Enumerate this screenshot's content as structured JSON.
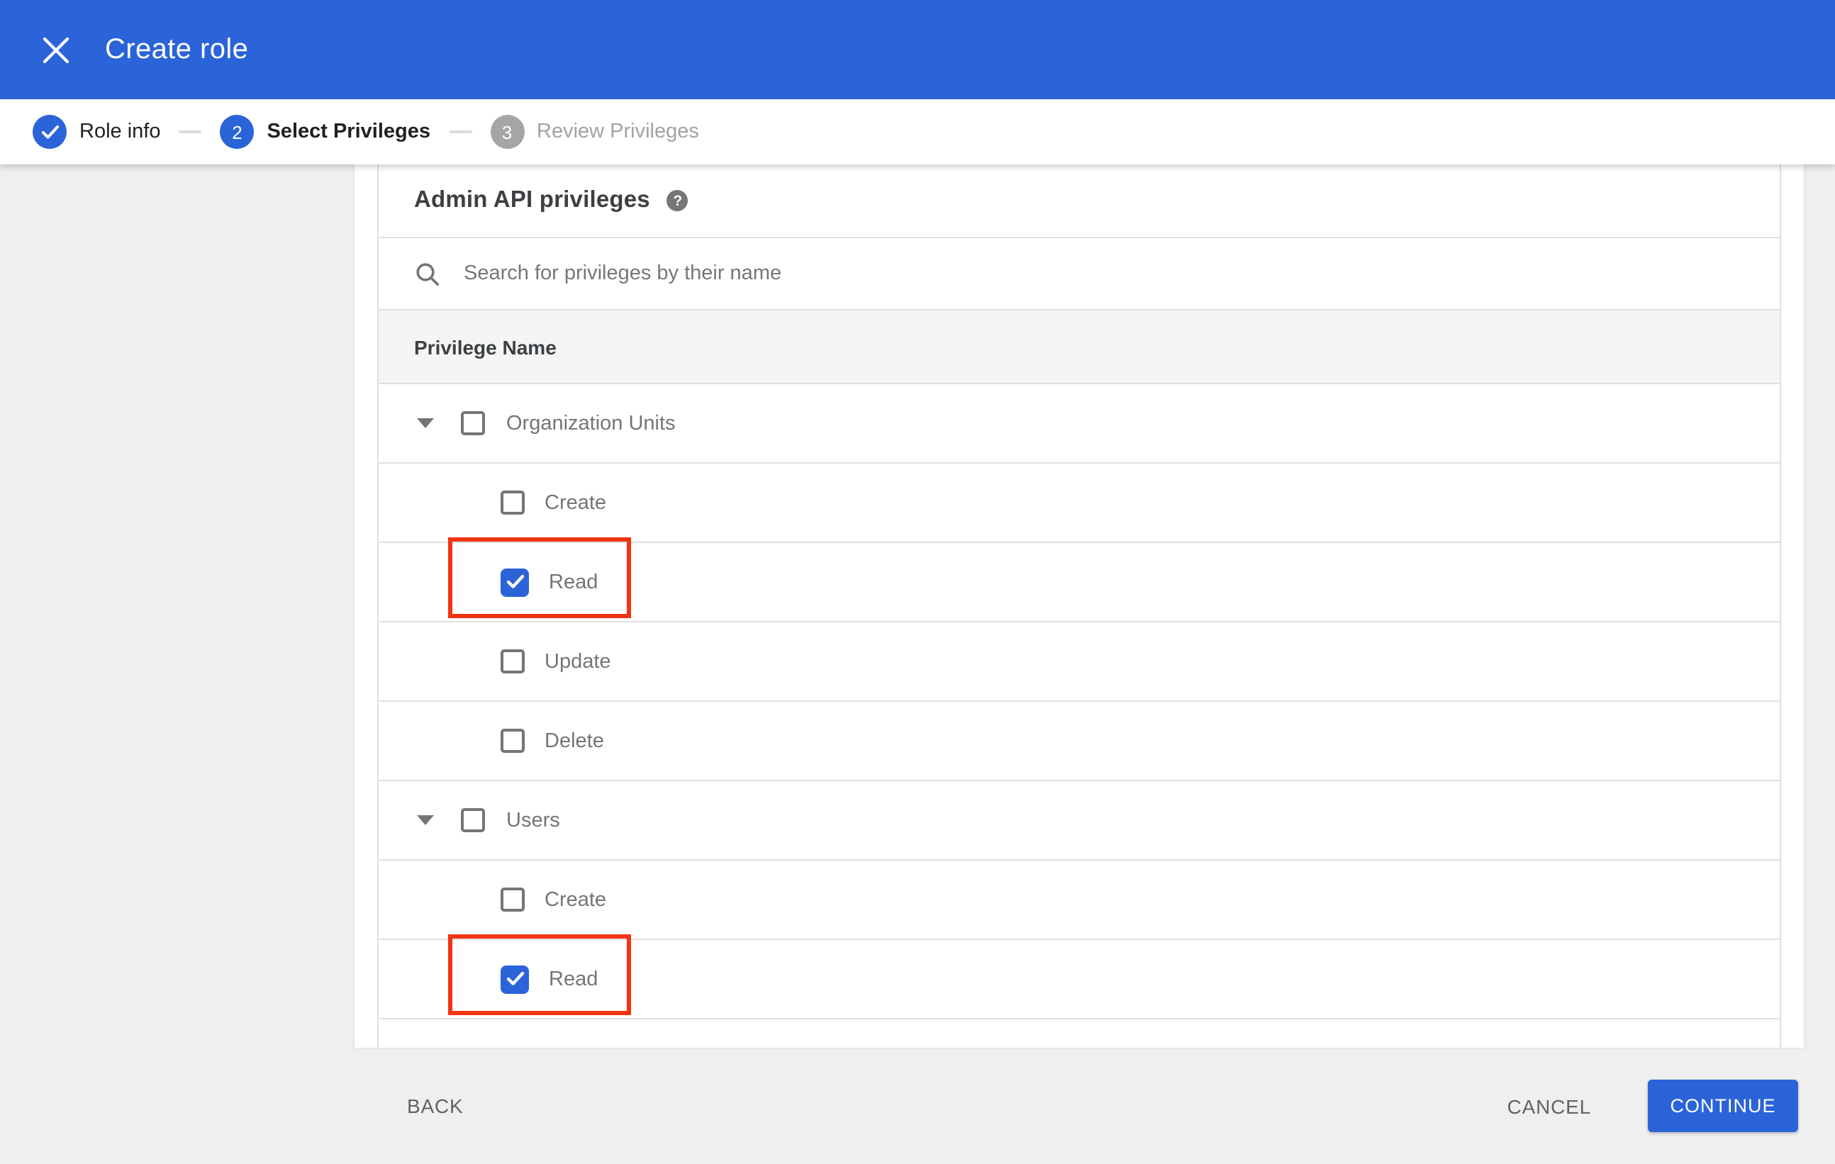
{
  "header": {
    "title": "Create role"
  },
  "stepper": {
    "steps": [
      {
        "num": "",
        "label": "Role info",
        "state": "done"
      },
      {
        "num": "2",
        "label": "Select Privileges",
        "state": "active"
      },
      {
        "num": "3",
        "label": "Review Privileges",
        "state": "upcoming"
      }
    ]
  },
  "content": {
    "section_title": "Admin API privileges",
    "help_icon": "?",
    "search_placeholder": "Search for privileges by their name",
    "table": {
      "header": "Privilege Name",
      "rows": [
        {
          "label": "Organization Units",
          "type": "group",
          "checked": false
        },
        {
          "label": "Create",
          "type": "child",
          "checked": false
        },
        {
          "label": "Read",
          "type": "child",
          "checked": true,
          "highlighted": true
        },
        {
          "label": "Update",
          "type": "child",
          "checked": false
        },
        {
          "label": "Delete",
          "type": "child",
          "checked": false
        },
        {
          "label": "Users",
          "type": "group",
          "checked": false
        },
        {
          "label": "Create",
          "type": "child",
          "checked": false
        },
        {
          "label": "Read",
          "type": "child",
          "checked": true,
          "highlighted": true
        }
      ]
    }
  },
  "footer": {
    "back_label": "BACK",
    "cancel_label": "CANCEL",
    "continue_label": "CONTINUE"
  },
  "colors": {
    "accent_blue": "#2b63d9",
    "annotation_red": "#f23411",
    "inactive_step_gray": "#a5a5a5"
  }
}
